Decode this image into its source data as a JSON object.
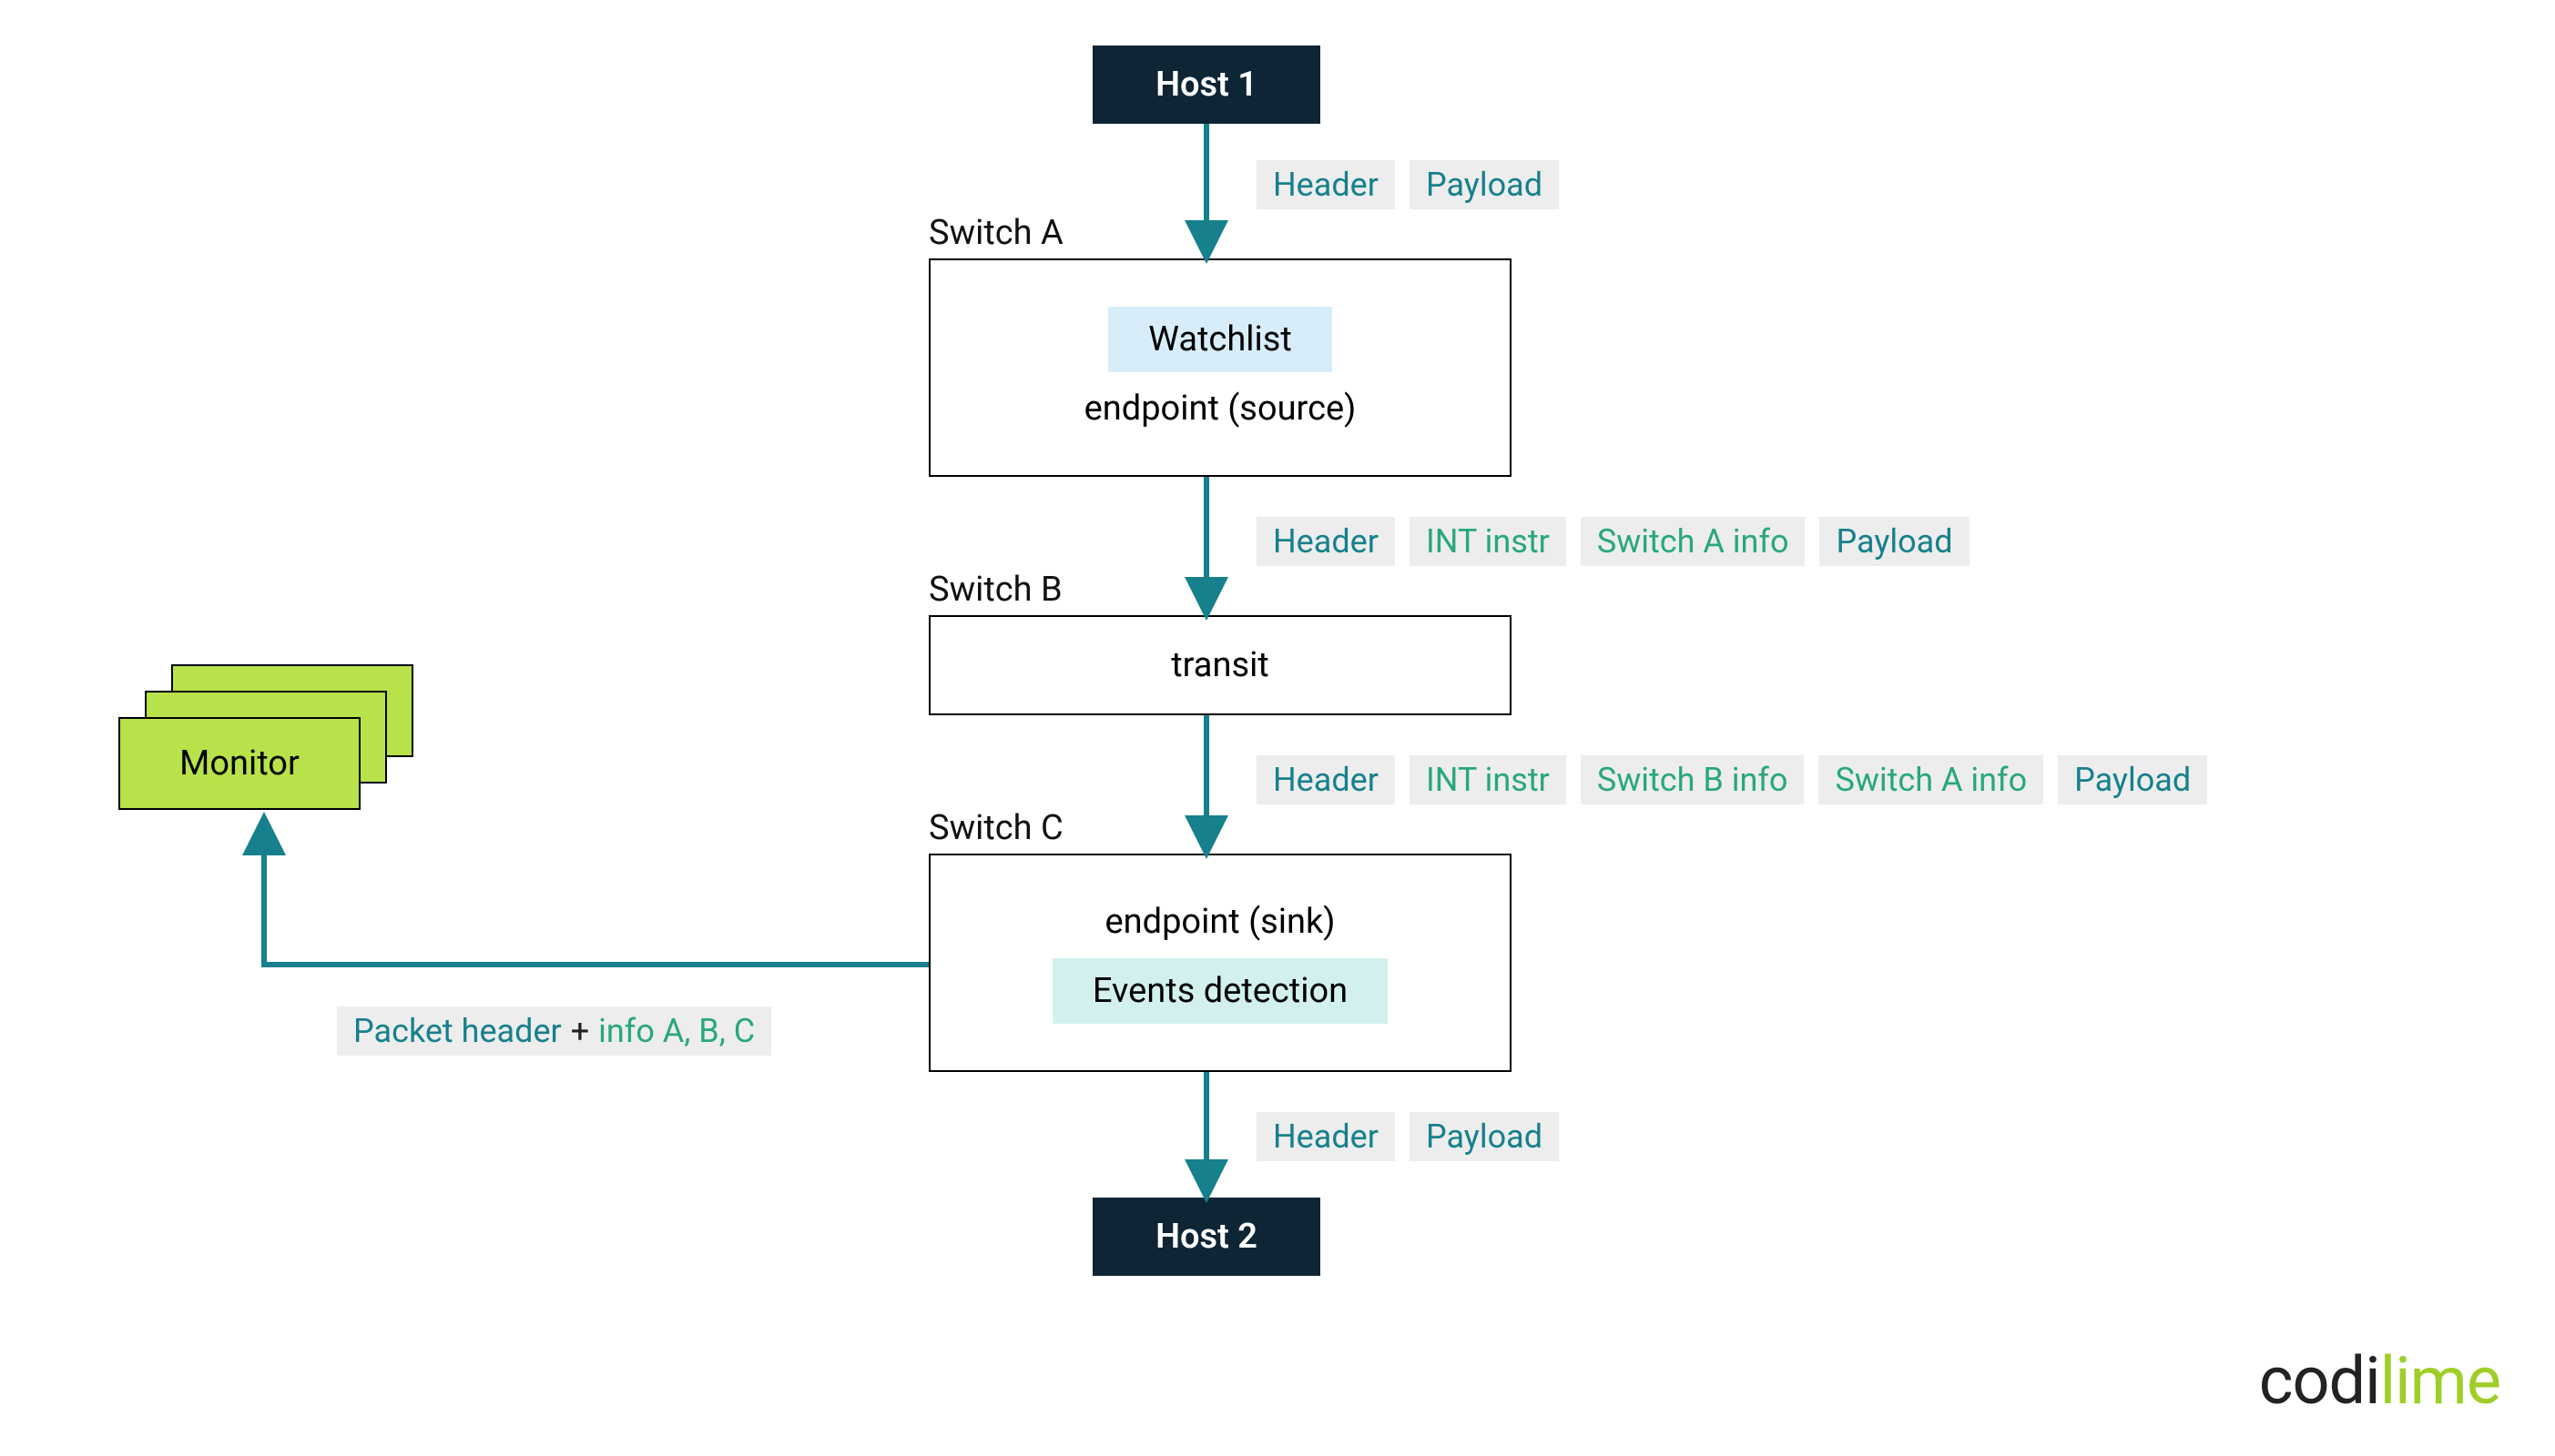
{
  "hosts": {
    "host1": "Host 1",
    "host2": "Host 2"
  },
  "switches": {
    "a": {
      "label": "Switch A",
      "inner": "Watchlist",
      "endpoint": "endpoint (source)"
    },
    "b": {
      "label": "Switch B",
      "text": "transit"
    },
    "c": {
      "label": "Switch C",
      "endpoint": "endpoint (sink)",
      "inner": "Events detection"
    }
  },
  "packets": {
    "p1": [
      {
        "text": "Header",
        "cls": "teal"
      },
      {
        "text": "Payload",
        "cls": "teal"
      }
    ],
    "p2": [
      {
        "text": "Header",
        "cls": "teal"
      },
      {
        "text": "INT instr",
        "cls": "green"
      },
      {
        "text": "Switch A info",
        "cls": "green"
      },
      {
        "text": "Payload",
        "cls": "teal"
      }
    ],
    "p3": [
      {
        "text": "Header",
        "cls": "teal"
      },
      {
        "text": "INT instr",
        "cls": "green"
      },
      {
        "text": "Switch B info",
        "cls": "green"
      },
      {
        "text": "Switch A info",
        "cls": "green"
      },
      {
        "text": "Payload",
        "cls": "teal"
      }
    ],
    "p4": [
      {
        "text": "Header",
        "cls": "teal"
      },
      {
        "text": "Payload",
        "cls": "teal"
      }
    ]
  },
  "monitor": {
    "label": "Monitor",
    "packet_info_a": "Packet header",
    "packet_info_plus": "+",
    "packet_info_b": "info A, B, C"
  },
  "logo": {
    "codi": "codi",
    "lime": "lime"
  },
  "colors": {
    "teal": "#16808c",
    "green": "#28a879",
    "lime": "#b7e24a",
    "darknavy": "#0d2535",
    "lightblue": "#d7edf9",
    "lightteal": "#d2f1ee"
  }
}
